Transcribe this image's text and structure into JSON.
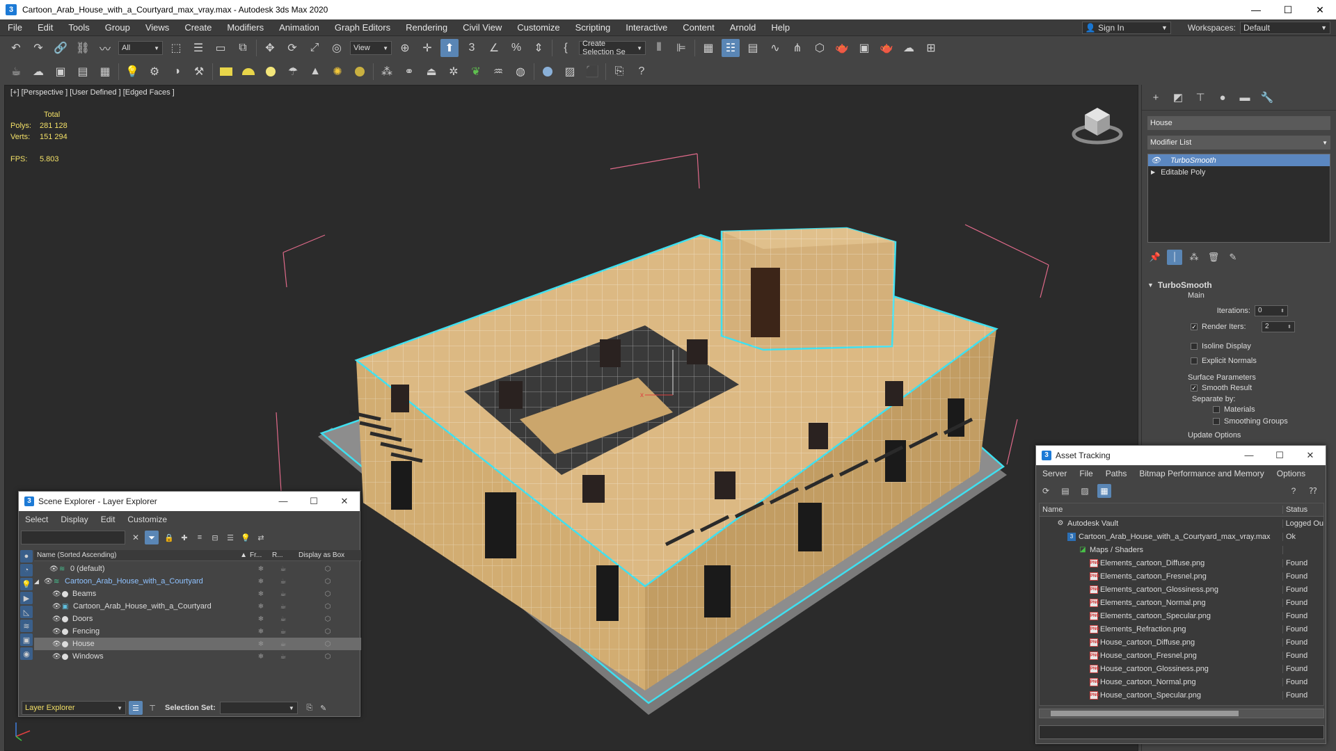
{
  "window": {
    "title": "Cartoon_Arab_House_with_a_Courtyard_max_vray.max - Autodesk 3ds Max 2020",
    "app_icon_label": "3",
    "minimize": "—",
    "maximize": "☐",
    "close": "✕"
  },
  "menu": [
    "File",
    "Edit",
    "Tools",
    "Group",
    "Views",
    "Create",
    "Modifiers",
    "Animation",
    "Graph Editors",
    "Rendering",
    "Civil View",
    "Customize",
    "Scripting",
    "Interactive",
    "Content",
    "Arnold",
    "Help"
  ],
  "signin": {
    "label": "Sign In",
    "icon": "user-icon"
  },
  "workspaces": {
    "label": "Workspaces:",
    "value": "Default"
  },
  "toolbar": {
    "selection_filter": "All",
    "reference_coord": "View",
    "selection_set": "Create Selection Se"
  },
  "viewport": {
    "label": "[+] [Perspective ] [User Defined ] [Edged Faces ]",
    "stats": {
      "header": "Total",
      "polys_label": "Polys:",
      "polys": "281 128",
      "verts_label": "Verts:",
      "verts": "151 294",
      "fps_label": "FPS:",
      "fps": "5.803"
    }
  },
  "command_panel": {
    "object_name": "House",
    "modifier_list": "Modifier List",
    "stack": [
      {
        "label": "TurboSmooth",
        "selected": true
      },
      {
        "label": "Editable Poly",
        "selected": false
      }
    ],
    "rollout_title": "TurboSmooth",
    "main_label": "Main",
    "iterations_label": "Iterations:",
    "iterations": "0",
    "render_iters_label": "Render Iters:",
    "render_iters": "2",
    "isoline_display": "Isoline Display",
    "explicit_normals": "Explicit Normals",
    "surface_params": "Surface Parameters",
    "smooth_result": "Smooth Result",
    "separate_by": "Separate by:",
    "materials": "Materials",
    "smoothing_groups": "Smoothing Groups",
    "update_options": "Update Options",
    "checkmark": "✓"
  },
  "scene_explorer": {
    "title": "Scene Explorer - Layer Explorer",
    "menu": [
      "Select",
      "Display",
      "Edit",
      "Customize"
    ],
    "search_clear": "✕",
    "columns": {
      "name": "Name (Sorted Ascending)",
      "sort_arrow": "▲",
      "frozen": "Fr...",
      "render": "R...",
      "box": "Display as Box"
    },
    "rows": [
      {
        "name": "0 (default)",
        "type": "layer",
        "level": 0
      },
      {
        "name": "Cartoon_Arab_House_with_a_Courtyard",
        "type": "layer",
        "level": 0,
        "expanded": true,
        "highlight": true
      },
      {
        "name": "Beams",
        "type": "object",
        "level": 1
      },
      {
        "name": "Cartoon_Arab_House_with_a_Courtyard",
        "type": "group",
        "level": 1
      },
      {
        "name": "Doors",
        "type": "object",
        "level": 1
      },
      {
        "name": "Fencing",
        "type": "object",
        "level": 1
      },
      {
        "name": "House",
        "type": "object",
        "level": 1,
        "selected": true
      },
      {
        "name": "Windows",
        "type": "object",
        "level": 1
      }
    ],
    "bottom": {
      "layer_explorer": "Layer Explorer",
      "selection_set": "Selection Set:"
    }
  },
  "asset_tracking": {
    "title": "Asset Tracking",
    "menu": [
      "Server",
      "File",
      "Paths",
      "Bitmap Performance and Memory",
      "Options"
    ],
    "columns": {
      "name": "Name",
      "status": "Status"
    },
    "rows": [
      {
        "name": "Autodesk Vault",
        "status": "Logged Ou",
        "icon": "vault",
        "indent": 1
      },
      {
        "name": "Cartoon_Arab_House_with_a_Courtyard_max_vray.max",
        "status": "Ok",
        "icon": "file",
        "indent": 2
      },
      {
        "name": "Maps / Shaders",
        "status": "",
        "icon": "folder",
        "indent": 3
      },
      {
        "name": "Elements_cartoon_Diffuse.png",
        "status": "Found",
        "icon": "png",
        "indent": 4
      },
      {
        "name": "Elements_cartoon_Fresnel.png",
        "status": "Found",
        "icon": "png",
        "indent": 4
      },
      {
        "name": "Elements_cartoon_Glossiness.png",
        "status": "Found",
        "icon": "png",
        "indent": 4
      },
      {
        "name": "Elements_cartoon_Normal.png",
        "status": "Found",
        "icon": "png",
        "indent": 4
      },
      {
        "name": "Elements_cartoon_Specular.png",
        "status": "Found",
        "icon": "png",
        "indent": 4
      },
      {
        "name": "Elements_Refraction.png",
        "status": "Found",
        "icon": "png",
        "indent": 4
      },
      {
        "name": "House_cartoon_Diffuse.png",
        "status": "Found",
        "icon": "png",
        "indent": 4
      },
      {
        "name": "House_cartoon_Fresnel.png",
        "status": "Found",
        "icon": "png",
        "indent": 4
      },
      {
        "name": "House_cartoon_Glossiness.png",
        "status": "Found",
        "icon": "png",
        "indent": 4
      },
      {
        "name": "House_cartoon_Normal.png",
        "status": "Found",
        "icon": "png",
        "indent": 4
      },
      {
        "name": "House_cartoon_Specular.png",
        "status": "Found",
        "icon": "png",
        "indent": 4
      }
    ]
  },
  "colors": {
    "accent": "#5b87c0",
    "stats_yellow": "#f3e067",
    "house_tan": "#d6b27a",
    "selection_cyan": "#3fe0f0"
  }
}
